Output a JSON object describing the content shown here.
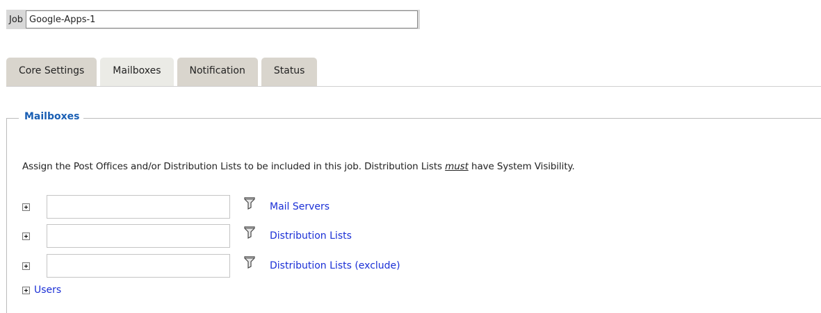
{
  "job": {
    "label": "Job",
    "name_value": "Google-Apps-1"
  },
  "tabs": [
    {
      "label": "Core Settings",
      "active": false
    },
    {
      "label": "Mailboxes",
      "active": true
    },
    {
      "label": "Notification",
      "active": false
    },
    {
      "label": "Status",
      "active": false
    }
  ],
  "section": {
    "legend": "Mailboxes",
    "description_before": "Assign the Post Offices and/or Distribution Lists to be included in this job. Distribution Lists ",
    "description_emphasis": "must",
    "description_after": " have System Visibility."
  },
  "rows": [
    {
      "input_value": "",
      "link_label": "Mail Servers",
      "icon": "filter-icon",
      "expander_icon": "plus-box-icon"
    },
    {
      "input_value": "",
      "link_label": "Distribution Lists",
      "icon": "filter-icon",
      "expander_icon": "plus-box-icon"
    },
    {
      "input_value": "",
      "link_label": "Distribution Lists (exclude)",
      "icon": "filter-icon",
      "expander_icon": "plus-box-icon"
    }
  ],
  "users": {
    "label": "Users",
    "expander_icon": "plus-box-icon"
  },
  "colors": {
    "link": "#1a2fd6",
    "legend": "#1a5fb4",
    "tab_bg": "#d9d5cd",
    "tab_active_bg": "#ebebe6"
  }
}
